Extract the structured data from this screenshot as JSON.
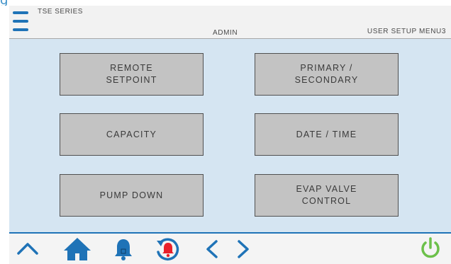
{
  "header": {
    "series": "TSE SERIES",
    "role": "ADMIN",
    "menu_title": "USER SETUP MENU3",
    "menu_icon": "hamburger-menu-icon"
  },
  "menu_buttons": [
    {
      "label": "REMOTE\nSETPOINT"
    },
    {
      "label": "PRIMARY /\nSECONDARY"
    },
    {
      "label": "CAPACITY"
    },
    {
      "label": "DATE / TIME"
    },
    {
      "label": "PUMP DOWN"
    },
    {
      "label": "EVAP VALVE\nCONTROL"
    }
  ],
  "footer": {
    "icons": [
      "chevron-up-icon",
      "home-icon",
      "bell-icon",
      "alarm-history-icon",
      "chevron-left-icon",
      "chevron-right-icon",
      "power-icon"
    ]
  },
  "colors": {
    "accent_blue": "#1f73b7",
    "alarm_red": "#e8202a",
    "power_green": "#6cc04a",
    "panel_bg": "#d5e5f2",
    "button_gray": "#c3c3c3"
  }
}
